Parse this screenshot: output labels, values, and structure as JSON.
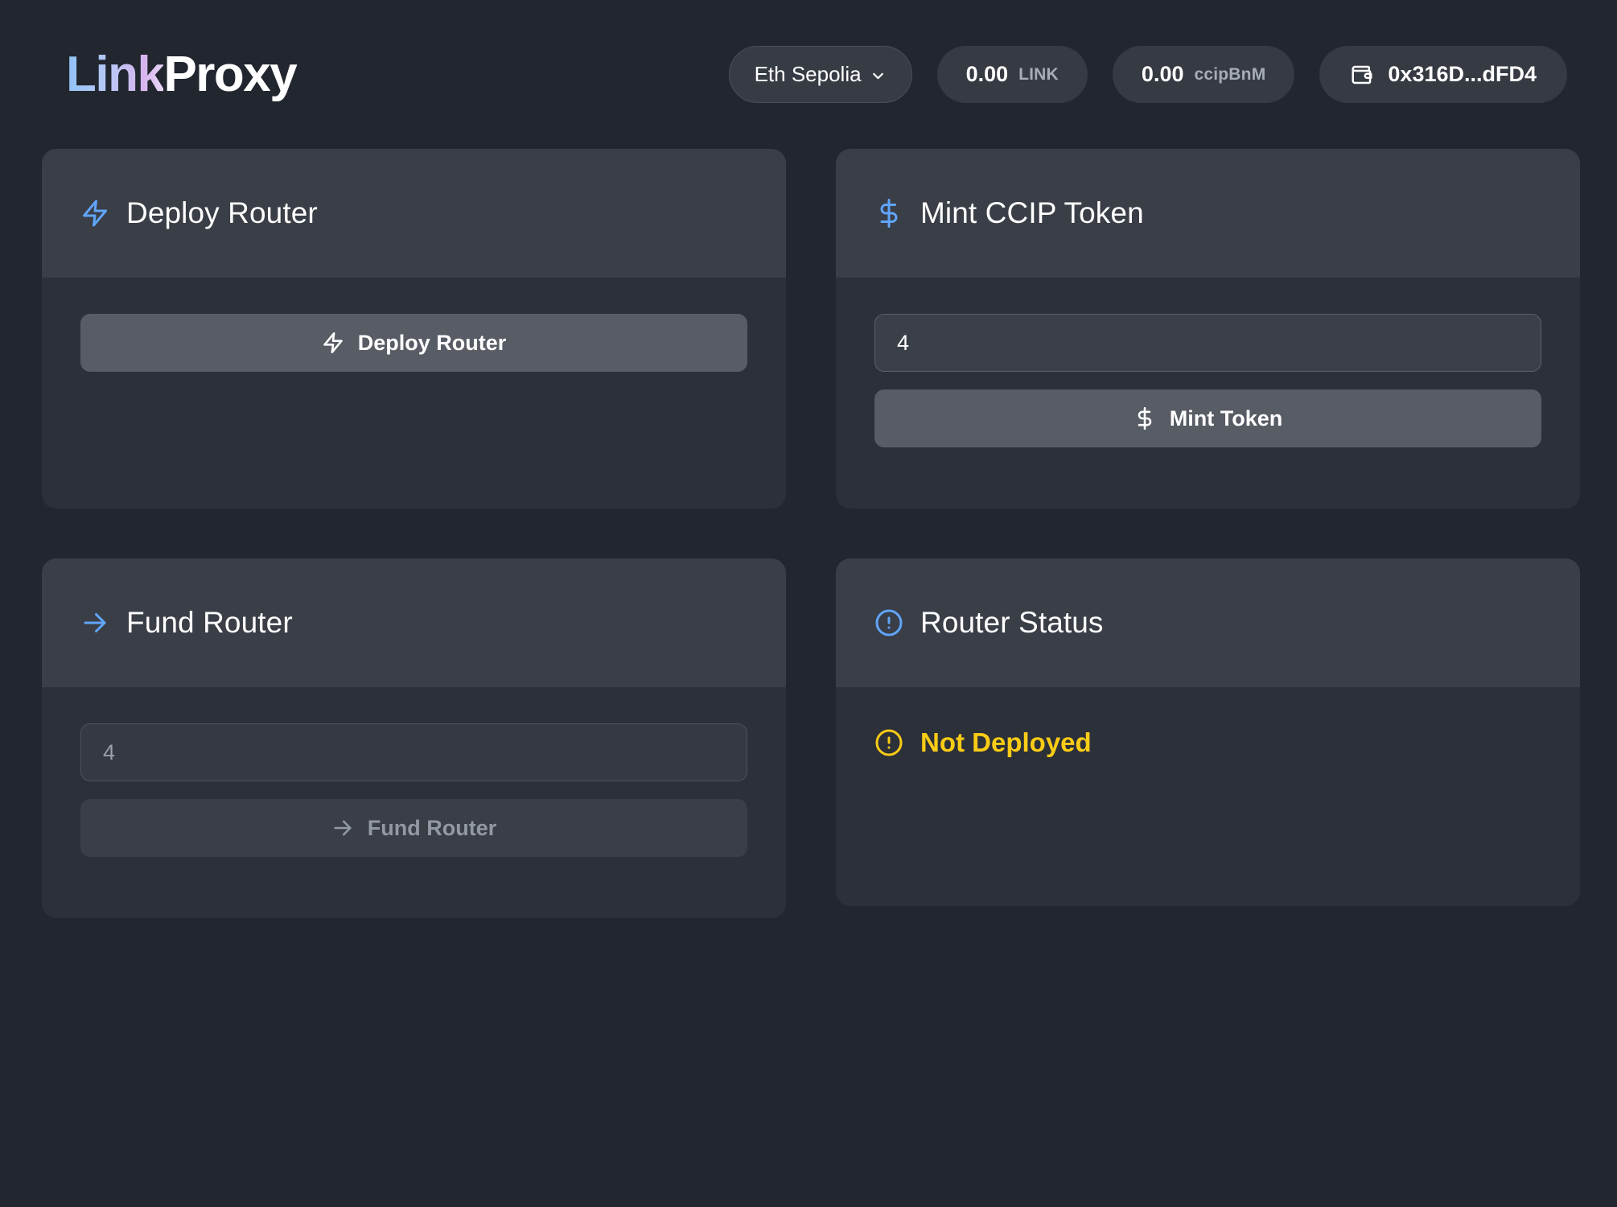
{
  "header": {
    "logo": {
      "prefix": "Link",
      "suffix": "Proxy",
      "gradient_start": "#8ec2f5",
      "gradient_mid": "#d6b4ee",
      "gradient_end": "#ffffff"
    },
    "network": {
      "label": "Eth Sepolia",
      "chevron_icon": "chevron-down-icon"
    },
    "balances": [
      {
        "amount": "0.00",
        "symbol": "LINK"
      },
      {
        "amount": "0.00",
        "symbol": "ccipBnM"
      }
    ],
    "wallet": {
      "icon": "wallet-icon",
      "address": "0x316D...dFD4"
    }
  },
  "cards": {
    "deploy": {
      "icon": "lightning-bolt-icon",
      "title": "Deploy Router",
      "button": {
        "icon": "lightning-bolt-icon",
        "label": "Deploy Router",
        "state": "enabled"
      }
    },
    "mint": {
      "icon": "dollar-sign-icon",
      "title": "Mint CCIP Token",
      "input": {
        "value": "4",
        "placeholder": "4",
        "state": "filled"
      },
      "button": {
        "icon": "dollar-sign-icon",
        "label": "Mint Token",
        "state": "enabled"
      }
    },
    "fund": {
      "icon": "arrow-right-icon",
      "title": "Fund Router",
      "input": {
        "value": "",
        "placeholder": "4",
        "state": "placeholder"
      },
      "button": {
        "icon": "arrow-right-icon",
        "label": "Fund Router",
        "state": "disabled"
      }
    },
    "status": {
      "icon": "alert-circle-icon",
      "title": "Router Status",
      "value": {
        "icon": "alert-circle-icon",
        "text": "Not Deployed",
        "color": "#facc15"
      }
    }
  },
  "colors": {
    "page_background": "#22262e",
    "card_header": "#3a3e47",
    "card_body": "#2c3039",
    "accent_blue": "#60a5fa",
    "warning_yellow": "#facc15"
  }
}
